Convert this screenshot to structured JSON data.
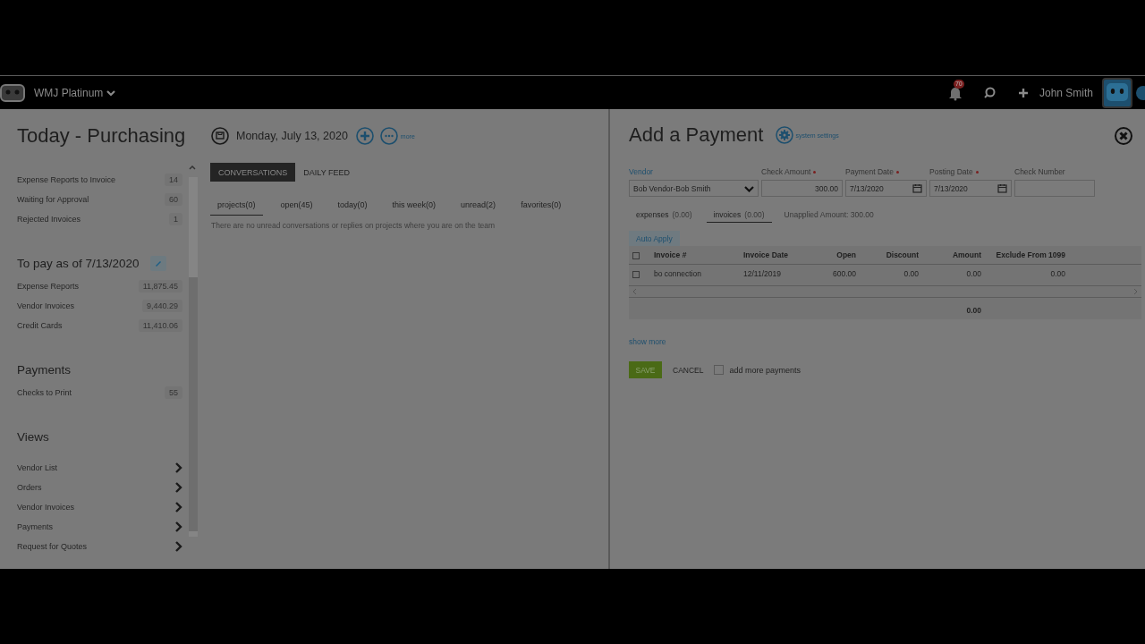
{
  "topbar": {
    "app_name": "WMJ Platinum",
    "notification_count": "70",
    "user_name": "John Smith"
  },
  "page": {
    "title": "Today - Purchasing",
    "date": "Monday, July 13, 2020",
    "more_label": "more"
  },
  "sidebar": {
    "sections": [
      {
        "items": [
          {
            "label": "Expense Reports to Invoice",
            "count": "14",
            "kind": "count"
          },
          {
            "label": "Waiting for Approval",
            "count": "60",
            "kind": "count"
          },
          {
            "label": "Rejected Invoices",
            "count": "1",
            "kind": "count"
          }
        ]
      },
      {
        "title": "To pay as of 7/13/2020",
        "editable": true,
        "items": [
          {
            "label": "Expense Reports",
            "count": "11,875.45",
            "kind": "count"
          },
          {
            "label": "Vendor Invoices",
            "count": "9,440.29",
            "kind": "count"
          },
          {
            "label": "Credit Cards",
            "count": "11,410.06",
            "kind": "count"
          }
        ]
      },
      {
        "title": "Payments",
        "editable": false,
        "items": [
          {
            "label": "Checks to Print",
            "count": "55",
            "kind": "count"
          }
        ]
      },
      {
        "title": "Views",
        "editable": false,
        "items": [
          {
            "label": "Vendor List",
            "kind": "link"
          },
          {
            "label": "Orders",
            "kind": "link"
          },
          {
            "label": "Vendor Invoices",
            "kind": "link"
          },
          {
            "label": "Payments",
            "kind": "link"
          },
          {
            "label": "Request for Quotes",
            "kind": "link"
          }
        ]
      }
    ]
  },
  "feed": {
    "tabs": [
      {
        "label": "CONVERSATIONS",
        "selected": true
      },
      {
        "label": "DAILY FEED",
        "selected": false
      }
    ],
    "filters": [
      {
        "label": "projects(0)",
        "selected": true
      },
      {
        "label": "open(45)",
        "selected": false
      },
      {
        "label": "today(0)",
        "selected": false
      },
      {
        "label": "this week(0)",
        "selected": false
      },
      {
        "label": "unread(2)",
        "selected": false
      },
      {
        "label": "favorites(0)",
        "selected": false
      }
    ],
    "empty_message": "There are no unread conversations or replies on projects where you are on the team"
  },
  "payment": {
    "title": "Add a Payment",
    "settings_label": "system settings",
    "fields": [
      {
        "label": "Vendor",
        "value": "Bob Vendor-Bob Smith",
        "kind": "select",
        "required": false,
        "focused": true
      },
      {
        "label": "Check Amount",
        "value": "300.00",
        "kind": "amount",
        "required": true,
        "focused": false
      },
      {
        "label": "Payment Date",
        "value": "7/13/2020",
        "kind": "date",
        "required": true,
        "focused": false
      },
      {
        "label": "Posting Date",
        "value": "7/13/2020",
        "kind": "date",
        "required": true,
        "focused": false
      },
      {
        "label": "Check Number",
        "kind": "text",
        "required": false,
        "focused": false
      }
    ],
    "subtabs": [
      {
        "label": "expenses",
        "amount": "(0.00)",
        "selected": false
      },
      {
        "label": "invoices",
        "amount": "(0.00)",
        "selected": true
      }
    ],
    "unapplied": "Unapplied Amount:  300.00",
    "auto_apply": "Auto Apply",
    "table": {
      "header_checked": false,
      "columns": [
        "Invoice #",
        "Invoice Date",
        "Open",
        "Discount",
        "Amount",
        "Exclude From 1099"
      ],
      "rows": [
        {
          "checked": false,
          "cells": [
            "bo connection",
            "12/11/2019",
            "600.00",
            "0.00",
            "0.00",
            "0.00"
          ]
        }
      ],
      "total": "0.00"
    },
    "show_more": "show more",
    "save": "SAVE",
    "cancel": "CANCEL",
    "add_more": {
      "label": "add more payments",
      "checked": false
    }
  }
}
